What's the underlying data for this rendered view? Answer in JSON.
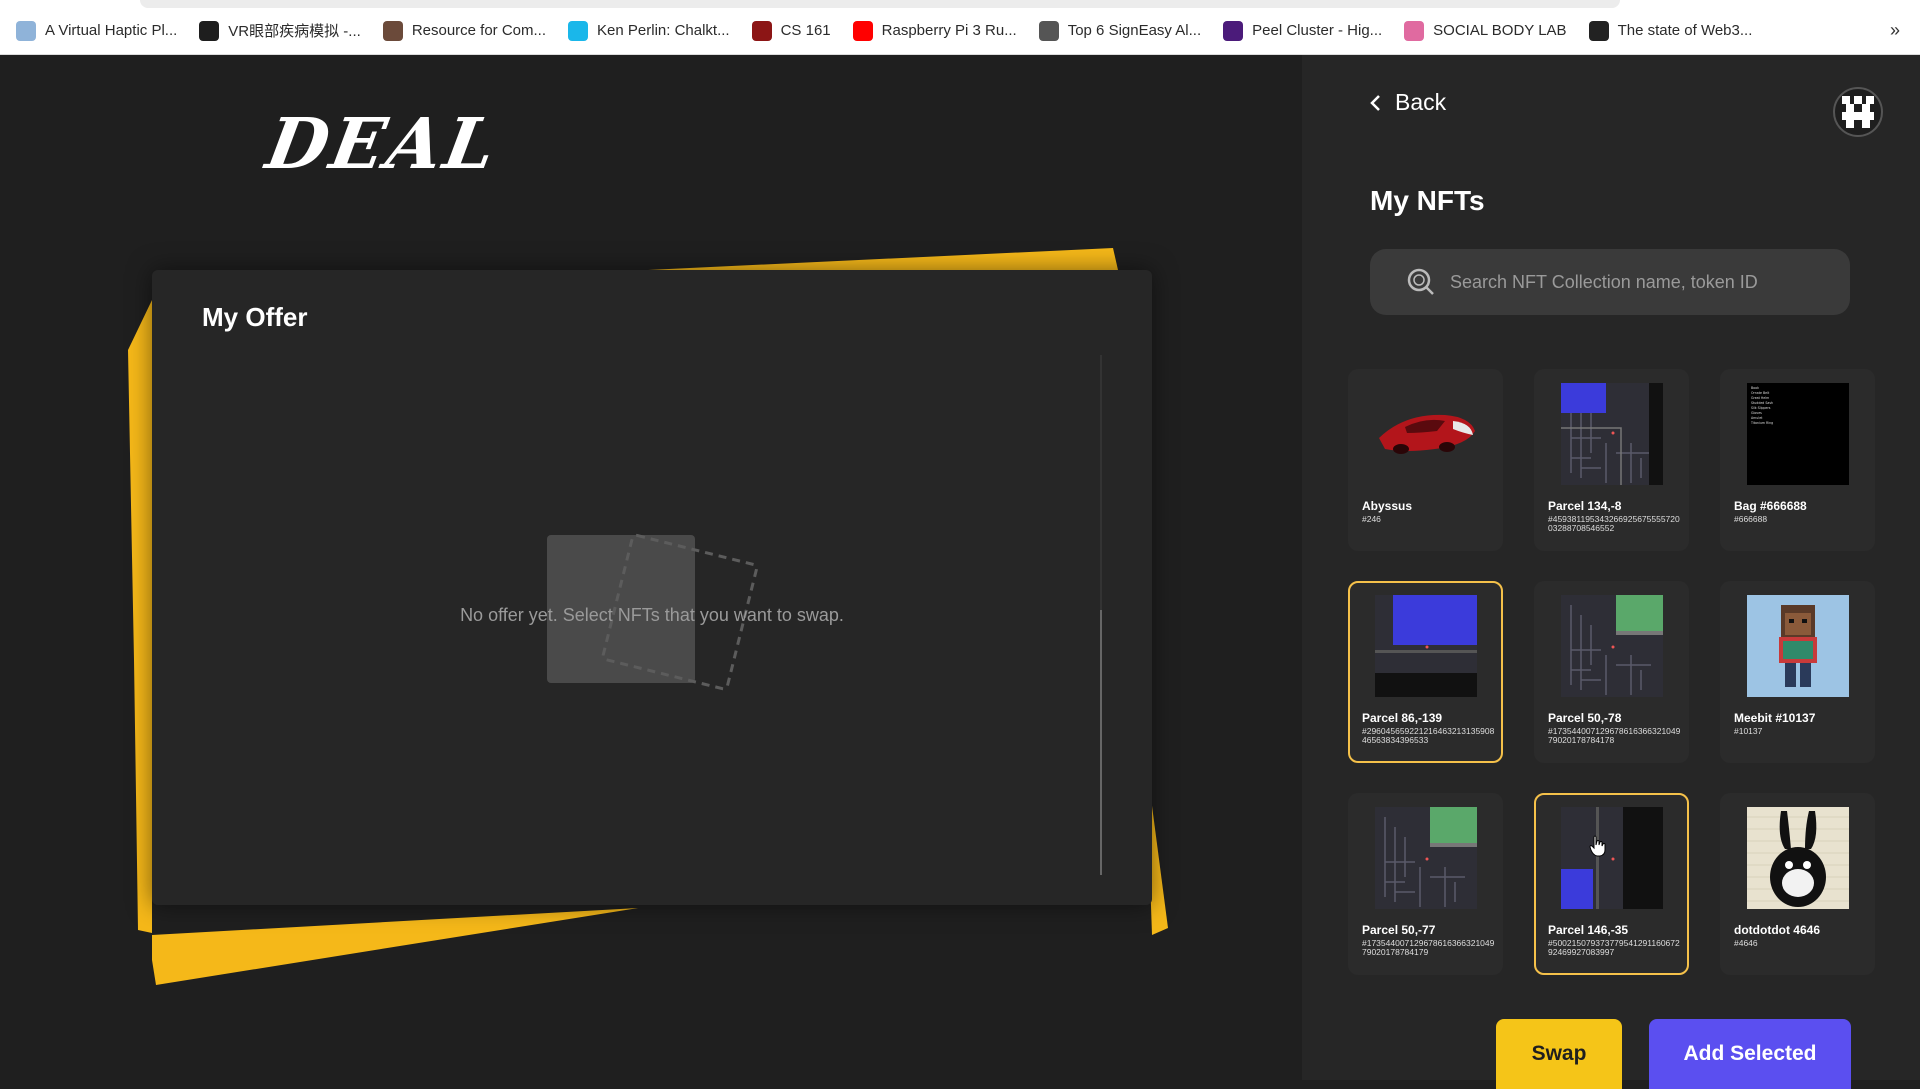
{
  "bookmarks": [
    {
      "label": "A Virtual Haptic Pl...",
      "icon": "sparkle-icon",
      "color": "#8fb3d9"
    },
    {
      "label": "VR眼部疾病模拟 -...",
      "icon": "vscode-icon",
      "color": "#1e1e1e"
    },
    {
      "label": "Resource for Com...",
      "icon": "person-icon",
      "color": "#6b4a3a"
    },
    {
      "label": "Ken Perlin: Chalkt...",
      "icon": "vimeo-icon",
      "color": "#1ab7ea"
    },
    {
      "label": "CS 161",
      "icon": "stanford-icon",
      "color": "#8c1515"
    },
    {
      "label": "Raspberry Pi 3 Ru...",
      "icon": "youtube-icon",
      "color": "#ff0000"
    },
    {
      "label": "Top 6 SignEasy Al...",
      "icon": "globe-icon",
      "color": "#555555"
    },
    {
      "label": "Peel Cluster - Hig...",
      "icon": "peel-icon",
      "color": "#4b1b7a"
    },
    {
      "label": "SOCIAL BODY LAB",
      "icon": "social-body-icon",
      "color": "#e06aa0"
    },
    {
      "label": "The state of Web3...",
      "icon": "camera-icon",
      "color": "#222222"
    }
  ],
  "bookmarks_more": "»",
  "app": {
    "logo": "DEAL",
    "offer_title": "My Offer",
    "empty_message": "No offer yet. Select NFTs that you want to swap."
  },
  "panel": {
    "back_label": "Back",
    "title": "My NFTs",
    "search_placeholder": "Search NFT Collection name, token ID",
    "swap_label": "Swap",
    "add_selected_label": "Add Selected"
  },
  "nfts": [
    {
      "name": "Abyssus",
      "id": "#246",
      "selected": false,
      "thumb": "car"
    },
    {
      "name": "Parcel 134,-8",
      "id": "#45938119534326692567555572003288708546552",
      "selected": false,
      "thumb": "parcel-a"
    },
    {
      "name": "Bag #666688",
      "id": "#666688",
      "selected": false,
      "thumb": "bag"
    },
    {
      "name": "Parcel 86,-139",
      "id": "#29604565922121646321313590846563834396533",
      "selected": true,
      "thumb": "parcel-b"
    },
    {
      "name": "Parcel 50,-78",
      "id": "#17354400712967861636632104979020178784178",
      "selected": false,
      "thumb": "parcel-c"
    },
    {
      "name": "Meebit #10137",
      "id": "#10137",
      "selected": false,
      "thumb": "meebit"
    },
    {
      "name": "Parcel 50,-77",
      "id": "#17354400712967861636632104979020178784179",
      "selected": false,
      "thumb": "parcel-c"
    },
    {
      "name": "Parcel 146,-35",
      "id": "#50021507937377954129116067292469927083997",
      "selected": true,
      "thumb": "parcel-d"
    },
    {
      "name": "dotdotdot 4646",
      "id": "#4646",
      "selected": false,
      "thumb": "dotdotdot"
    }
  ],
  "colors": {
    "accent_yellow": "#f5c518",
    "accent_purple": "#5b4ff0",
    "selected_border": "#f5c14a"
  }
}
